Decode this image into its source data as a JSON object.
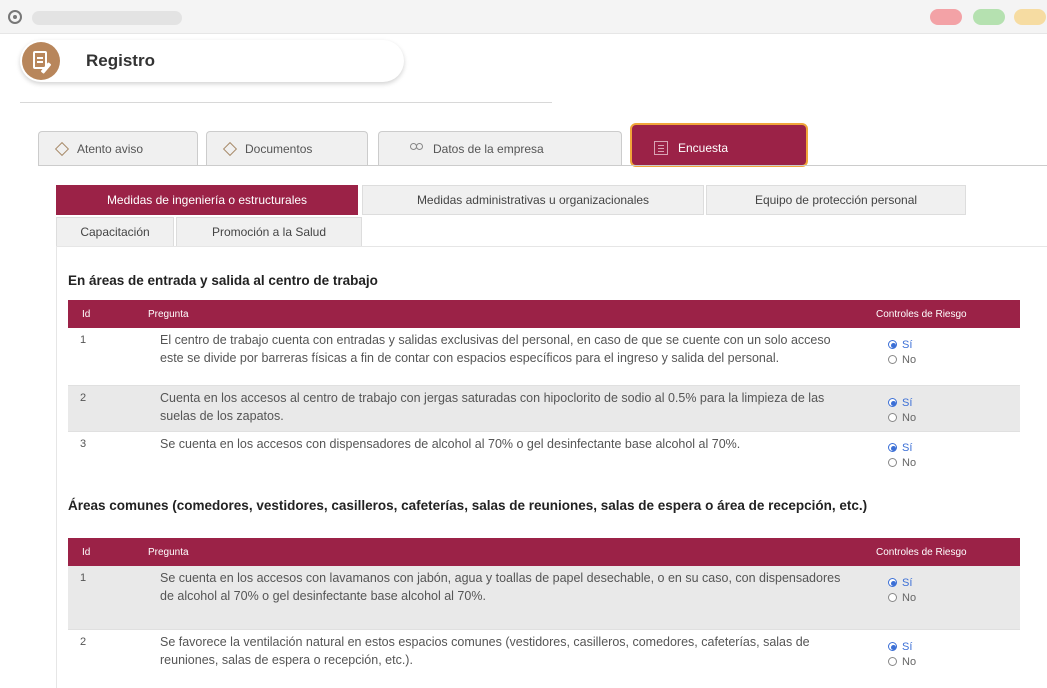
{
  "header": {
    "title": "Registro"
  },
  "main_tabs": [
    {
      "label": "Atento aviso"
    },
    {
      "label": "Documentos"
    },
    {
      "label": "Datos de la empresa"
    },
    {
      "label": "Encuesta"
    }
  ],
  "sub_tabs": [
    {
      "label": "Medidas de ingeniería o estructurales"
    },
    {
      "label": "Medidas administrativas u organizacionales"
    },
    {
      "label": "Equipo de protección personal"
    },
    {
      "label": "Capacitación"
    },
    {
      "label": "Promoción a la Salud"
    }
  ],
  "table_headers": {
    "id": "Id",
    "question": "Pregunta",
    "controls": "Controles de Riesgo"
  },
  "options": {
    "yes": "Sí",
    "no": "No"
  },
  "sections": [
    {
      "title": "En áreas de entrada y salida al centro de trabajo",
      "rows": [
        {
          "id": "1",
          "question": "El centro de trabajo cuenta con entradas y salidas exclusivas del personal, en caso de que se cuente con un solo acceso este se divide por barreras físicas a fin de contar con espacios específicos para el ingreso y salida del personal.",
          "selected": "yes"
        },
        {
          "id": "2",
          "question": "Cuenta en los accesos al centro de trabajo con jergas saturadas con hipoclorito de sodio al 0.5% para la limpieza de las suelas de los zapatos.",
          "selected": "yes"
        },
        {
          "id": "3",
          "question": "Se cuenta en los accesos con dispensadores de alcohol al 70% o gel desinfectante base alcohol al 70%.",
          "selected": "yes"
        }
      ]
    },
    {
      "title": "Áreas comunes (comedores, vestidores, casilleros, cafeterías, salas de reuniones, salas de espera o área de recepción, etc.)",
      "rows": [
        {
          "id": "1",
          "question": "Se cuenta en los accesos con lavamanos con jabón, agua y toallas de papel desechable, o en su caso, con dispensadores de alcohol al 70% o gel desinfectante base alcohol al 70%.",
          "selected": "yes"
        },
        {
          "id": "2",
          "question": "Se favorece la ventilación natural en estos espacios comunes (vestidores, casilleros, comedores, cafeterías, salas de reuniones, salas de espera o recepción, etc.).",
          "selected": "yes"
        }
      ]
    }
  ]
}
